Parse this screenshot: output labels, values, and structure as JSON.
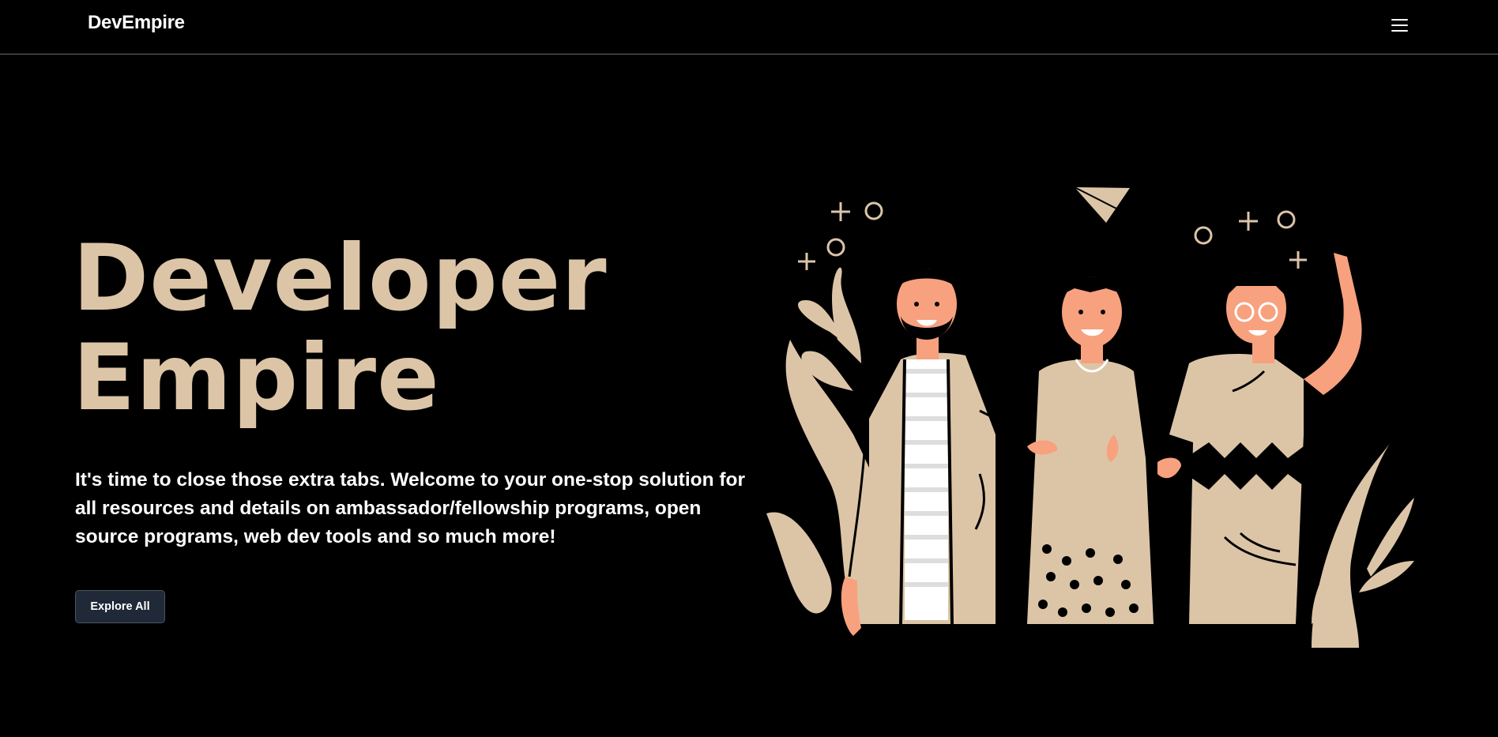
{
  "nav": {
    "brand": "DevEmpire",
    "menu_icon": "hamburger-menu-icon"
  },
  "hero": {
    "title_line1": "Developer",
    "title_line2": "Empire",
    "description": "It's time to close those extra tabs. Welcome to your one-stop solution for all resources and details on ambassador/fellowship programs, open source programs, web dev tools and so much more!",
    "cta_label": "Explore All"
  },
  "illustration": {
    "icon": "three-friends-illustration"
  },
  "colors": {
    "background": "#000000",
    "accent": "#dcc5a7",
    "skin": "#f8a17e",
    "button_bg": "#1f2937",
    "text": "#ffffff"
  }
}
